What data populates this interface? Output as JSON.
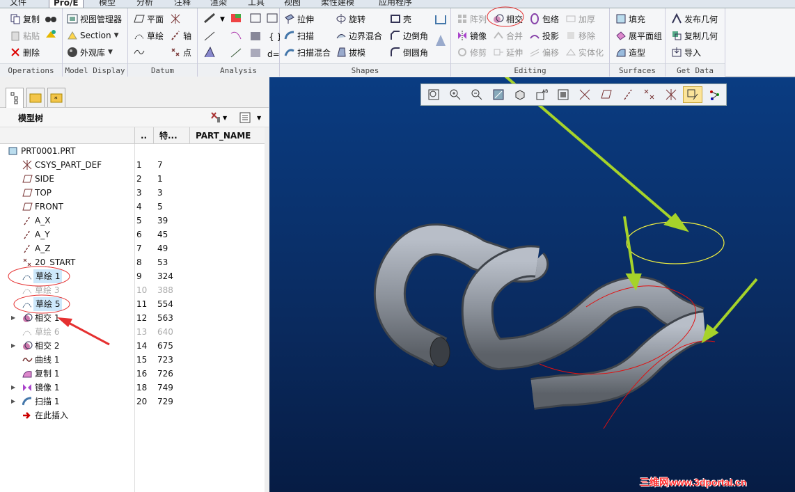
{
  "tabs": [
    "文件",
    "Pro/E",
    "模型",
    "分析",
    "注释",
    "渲染",
    "工具",
    "视图",
    "柔性建模",
    "应用程序"
  ],
  "ribbon": {
    "ops": [
      "复制",
      "粘贴",
      "删除"
    ],
    "model": [
      "视图管理器",
      "Section",
      "外观库"
    ],
    "datum": [
      "平面",
      "轴",
      "草绘",
      "点"
    ],
    "shapes1": [
      "拉伸",
      "扫描",
      "扫描混合"
    ],
    "shapes2": [
      "旋转",
      "边界混合",
      "拔模"
    ],
    "shapes3": [
      "壳",
      "边倒角",
      "倒圆角"
    ],
    "edit1": [
      "阵列",
      "镜像",
      "修剪"
    ],
    "edit2": [
      "相交",
      "合并",
      "延伸"
    ],
    "edit3": [
      "包络",
      "投影",
      "偏移"
    ],
    "edit4": [
      "加厚",
      "移除",
      "实体化"
    ],
    "surfaces": [
      "填充",
      "展平面组",
      "造型"
    ],
    "getdata": [
      "发布几何",
      "复制几何",
      "导入"
    ],
    "groups": [
      "Operations",
      "Model Display",
      "Datum",
      "Analysis",
      "Shapes",
      "Editing",
      "Surfaces",
      "Get Data"
    ]
  },
  "panel": {
    "title": "模型树",
    "cols": [
      "..",
      "特...",
      "PART_NAME"
    ]
  },
  "tree": [
    {
      "name": "PRT0001.PRT",
      "a": "",
      "b": ""
    },
    {
      "name": "CSYS_PART_DEF",
      "a": "1",
      "b": "7"
    },
    {
      "name": "SIDE",
      "a": "2",
      "b": "1"
    },
    {
      "name": "TOP",
      "a": "3",
      "b": "3"
    },
    {
      "name": "FRONT",
      "a": "4",
      "b": "5"
    },
    {
      "name": "A_X",
      "a": "5",
      "b": "39"
    },
    {
      "name": "A_Y",
      "a": "6",
      "b": "45"
    },
    {
      "name": "A_Z",
      "a": "7",
      "b": "49"
    },
    {
      "name": "20_START",
      "a": "8",
      "b": "53"
    },
    {
      "name": "草绘 1",
      "a": "9",
      "b": "324"
    },
    {
      "name": "草绘 3",
      "a": "10",
      "b": "388"
    },
    {
      "name": "草绘 5",
      "a": "11",
      "b": "554"
    },
    {
      "name": "相交 1",
      "a": "12",
      "b": "563"
    },
    {
      "name": "草绘 6",
      "a": "13",
      "b": "640"
    },
    {
      "name": "相交 2",
      "a": "14",
      "b": "675"
    },
    {
      "name": "曲线 1",
      "a": "15",
      "b": "723"
    },
    {
      "name": "复制 1",
      "a": "16",
      "b": "726"
    },
    {
      "name": "镜像 1",
      "a": "18",
      "b": "749"
    },
    {
      "name": "扫描 1",
      "a": "20",
      "b": "729"
    },
    {
      "name": "在此插入",
      "a": "",
      "b": ""
    }
  ],
  "watermark": "三维网www.3dportal.cn"
}
